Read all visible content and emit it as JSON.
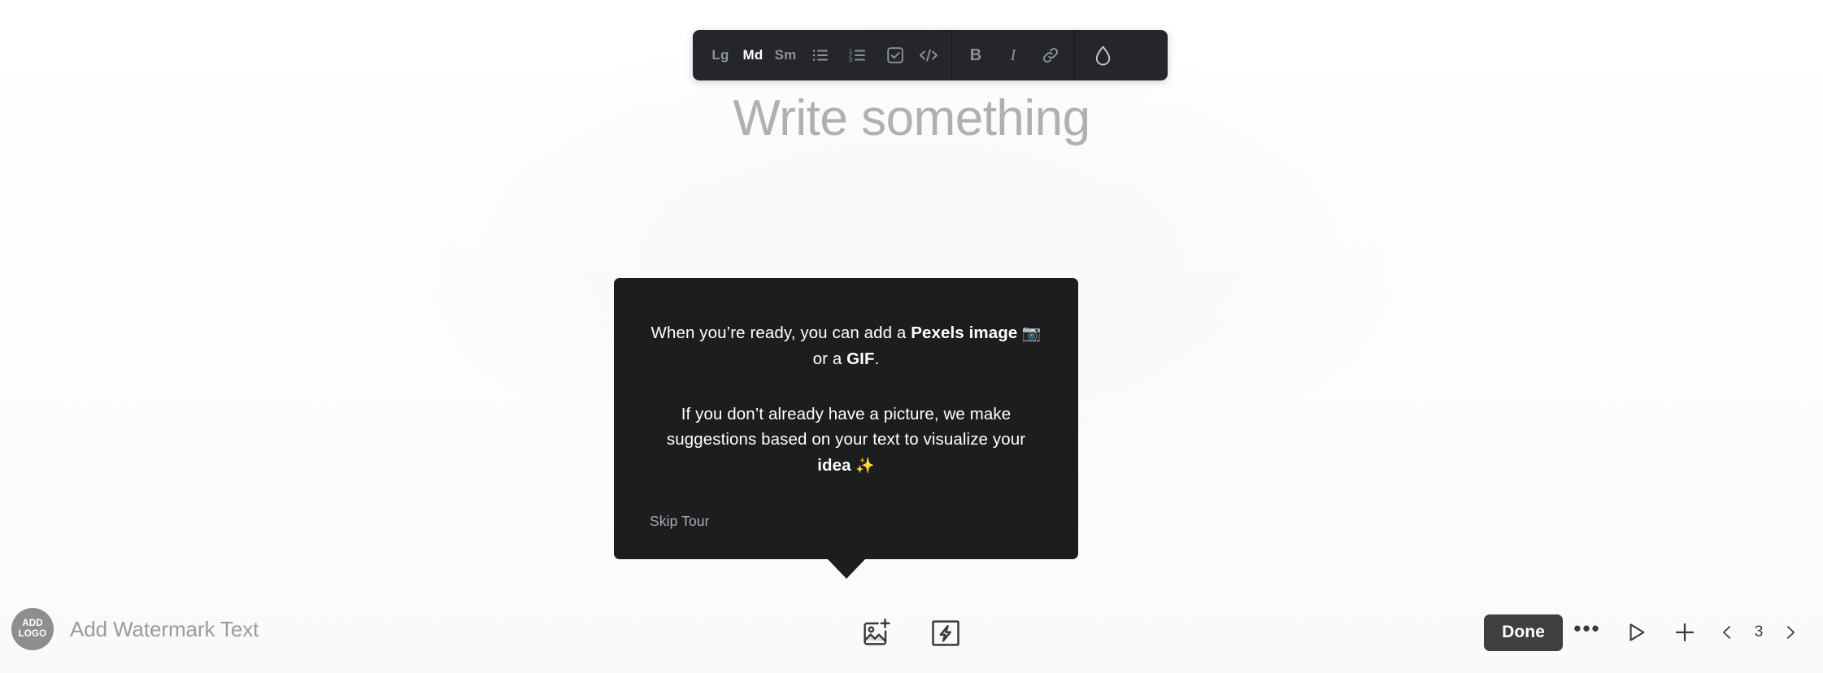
{
  "editor": {
    "placeholder": "Write something"
  },
  "toolbar": {
    "sizes": [
      {
        "label": "Lg",
        "name": "text-size-large",
        "active": false
      },
      {
        "label": "Md",
        "name": "text-size-medium",
        "active": true
      },
      {
        "label": "Sm",
        "name": "text-size-small",
        "active": false
      }
    ],
    "blocks": [
      {
        "name": "bulleted-list-icon"
      },
      {
        "name": "numbered-list-icon"
      },
      {
        "name": "checklist-icon"
      },
      {
        "name": "code-block-icon"
      }
    ],
    "inline": [
      {
        "label": "B",
        "name": "bold-button"
      },
      {
        "label": "I",
        "name": "italic-button"
      },
      {
        "label": "",
        "name": "link-icon"
      }
    ],
    "color": {
      "name": "text-color-droplet-icon"
    }
  },
  "coachmark": {
    "paragraph1": {
      "part1": "When you’re ready, you can add a ",
      "bold1": "Pexels image",
      "emoji": " 📷 ",
      "part2": "or a ",
      "bold2": "GIF",
      "part3": "."
    },
    "paragraph2": {
      "part1": "If you don’t already have a picture, we make suggestions based on your text to visualize your ",
      "bold1": "idea",
      "emoji": " ✨"
    },
    "skip_label": "Skip Tour"
  },
  "bottom": {
    "watermark": {
      "logo_line1": "ADD",
      "logo_line2": "LOGO",
      "text": "Add Watermark Text"
    },
    "media": [
      {
        "name": "add-image-button"
      },
      {
        "name": "quick-action-bolt-button"
      }
    ],
    "done_label": "Done",
    "more_label": "•••",
    "page_number": "3"
  },
  "colors": {
    "toolbar_bg": "#24262a",
    "coachmark_bg": "#1c1d1f",
    "done_bg": "#3f3f3f",
    "placeholder": "#b0b0b0",
    "watermark_text": "#9b9b9b"
  }
}
